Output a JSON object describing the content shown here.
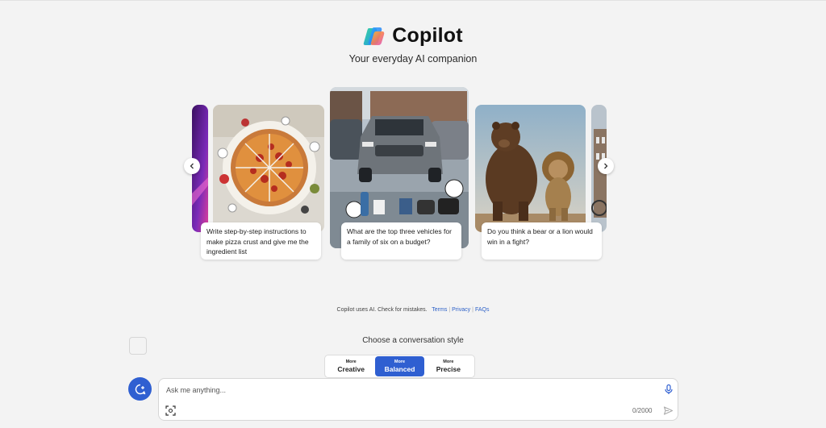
{
  "header": {
    "title": "Copilot",
    "tagline": "Your everyday AI companion"
  },
  "carousel": {
    "cards": [
      {
        "caption": "Write step-by-step instructions to make pizza crust and give me the ingredient list",
        "image": "pizza-image"
      },
      {
        "caption": "What are the top three vehicles for a family of six on a budget?",
        "image": "vehicles-image"
      },
      {
        "caption": "Do you think a bear or a lion would win in a fight?",
        "image": "bear-lion-image"
      }
    ],
    "prev_icon": "chevron-left-icon",
    "next_icon": "chevron-right-icon"
  },
  "notice": {
    "text": "Copilot uses AI. Check for mistakes.",
    "links": [
      "Terms",
      "Privacy",
      "FAQs"
    ]
  },
  "conversation_style": {
    "heading": "Choose a conversation style",
    "options": [
      {
        "more": "More",
        "name": "Creative",
        "active": false
      },
      {
        "more": "More",
        "name": "Balanced",
        "active": true
      },
      {
        "more": "More",
        "name": "Precise",
        "active": false
      }
    ]
  },
  "composer": {
    "placeholder": "Ask me anything...",
    "counter": "0/2000",
    "mic_icon": "microphone-icon",
    "image_icon": "image-capture-icon",
    "send_icon": "send-icon",
    "new_topic_icon": "new-topic-icon"
  },
  "colors": {
    "accent": "#2f5fd1",
    "link": "#2b5fc7",
    "background": "#f3f3f3"
  }
}
